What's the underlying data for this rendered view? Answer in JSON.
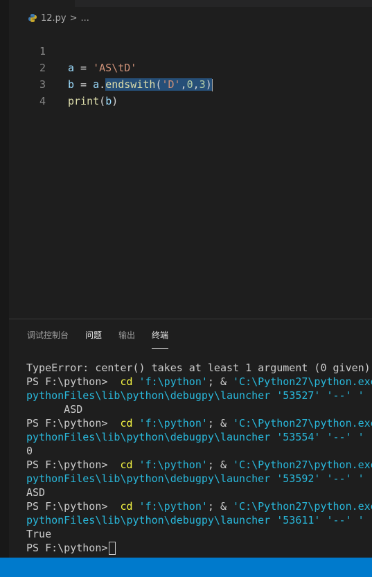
{
  "breadcrumb": {
    "file_name": "12.py",
    "separator": ">",
    "more": "..."
  },
  "editor": {
    "line_numbers": [
      "1",
      "2",
      "3",
      "4"
    ],
    "line1": {
      "var": "a",
      "op": " = ",
      "str": "'AS\\tD'"
    },
    "line2": {
      "var": "b",
      "op": " = ",
      "obj": "a",
      "dot": ".",
      "method": "endswith",
      "open": "(",
      "str": "'D'",
      "comma1": ",",
      "n1": "0",
      "comma2": ",",
      "n2": "3",
      "close": ")"
    },
    "line3": {
      "fn": "print",
      "open": "(",
      "arg": "b",
      "close": ")"
    }
  },
  "panel": {
    "tabs": [
      {
        "label": "调试控制台"
      },
      {
        "label": "问题"
      },
      {
        "label": "输出"
      },
      {
        "label": "终端"
      }
    ]
  },
  "terminal": {
    "error_line": "TypeError: center() takes at least 1 argument (0 given)",
    "prompt": "PS F:\\python> ",
    "cmd_cd": " cd",
    "cmd_path": " 'f:\\python'",
    "cmd_sep": "; & ",
    "cmd_exe": "'C:\\Python27\\python.exe'",
    "launcher_prefix": "pythonFiles\\lib\\python\\debugpy\\launcher ",
    "dashes": " '--' '",
    "runs": [
      {
        "port": "'53527'",
        "output": "      ASD"
      },
      {
        "port": "'53554'",
        "output": "0"
      },
      {
        "port": "'53592'",
        "output": "ASD"
      },
      {
        "port": "'53611'",
        "output": "True"
      }
    ],
    "final_prompt": "PS F:\\python>"
  },
  "colors": {
    "status_bar": "#007acc",
    "selection": "#264f78",
    "editor_bg": "#1e1e1e"
  }
}
